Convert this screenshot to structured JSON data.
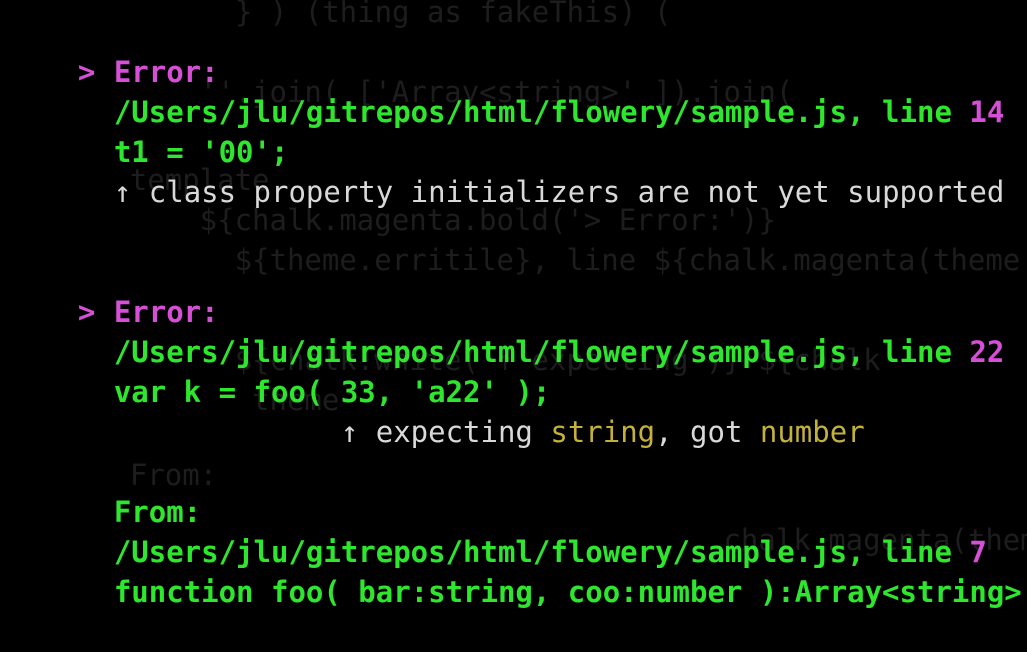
{
  "colors": {
    "background": "#000000",
    "error_label": "#d64fd6",
    "path_text": "#2ee62e",
    "line_number": "#d64fd6",
    "message_text": "#d9d9d9",
    "type_highlight": "#c4b13c"
  },
  "prompt_glyph": ">",
  "error1": {
    "label": "Error:",
    "path": "/Users/jlu/gitrepos/html/flowery/sample.js, line ",
    "line_number": "14",
    "code": "t1 = '00';",
    "caret": "↑",
    "message": " class property initializers are not yet supported"
  },
  "error2": {
    "label": "Error:",
    "path": "/Users/jlu/gitrepos/html/flowery/sample.js, line ",
    "line_number": "22",
    "code": "var k = foo( 33, 'a22' );",
    "caret_pad": "             ",
    "caret": "↑",
    "msg_part1": " expecting ",
    "type1": "string",
    "msg_part2": ", got ",
    "type2": "number",
    "from_label": "From:",
    "from_path": "/Users/jlu/gitrepos/html/flowery/sample.js, line ",
    "from_line_number": "7",
    "from_code": "function foo( bar:string, coo:number ):Array<string> {"
  },
  "background_ghost_lines": [
    "  } ) (thing as fakeThis) ( ",
    "",
    "        ''.join( ['Array<string>' ]).join(",
    "    template",
    "        ${chalk.magenta.bold('> Error:')}",
    "          ${theme.erritile}, line ${chalk.magenta(theme",
    "",
    "",
    "          ${chalk.white('↑ expecting')} ${chalk",
    "           theme",
    "",
    "    From:",
    "",
    "                                      chalk.magenta(theme"
  ]
}
